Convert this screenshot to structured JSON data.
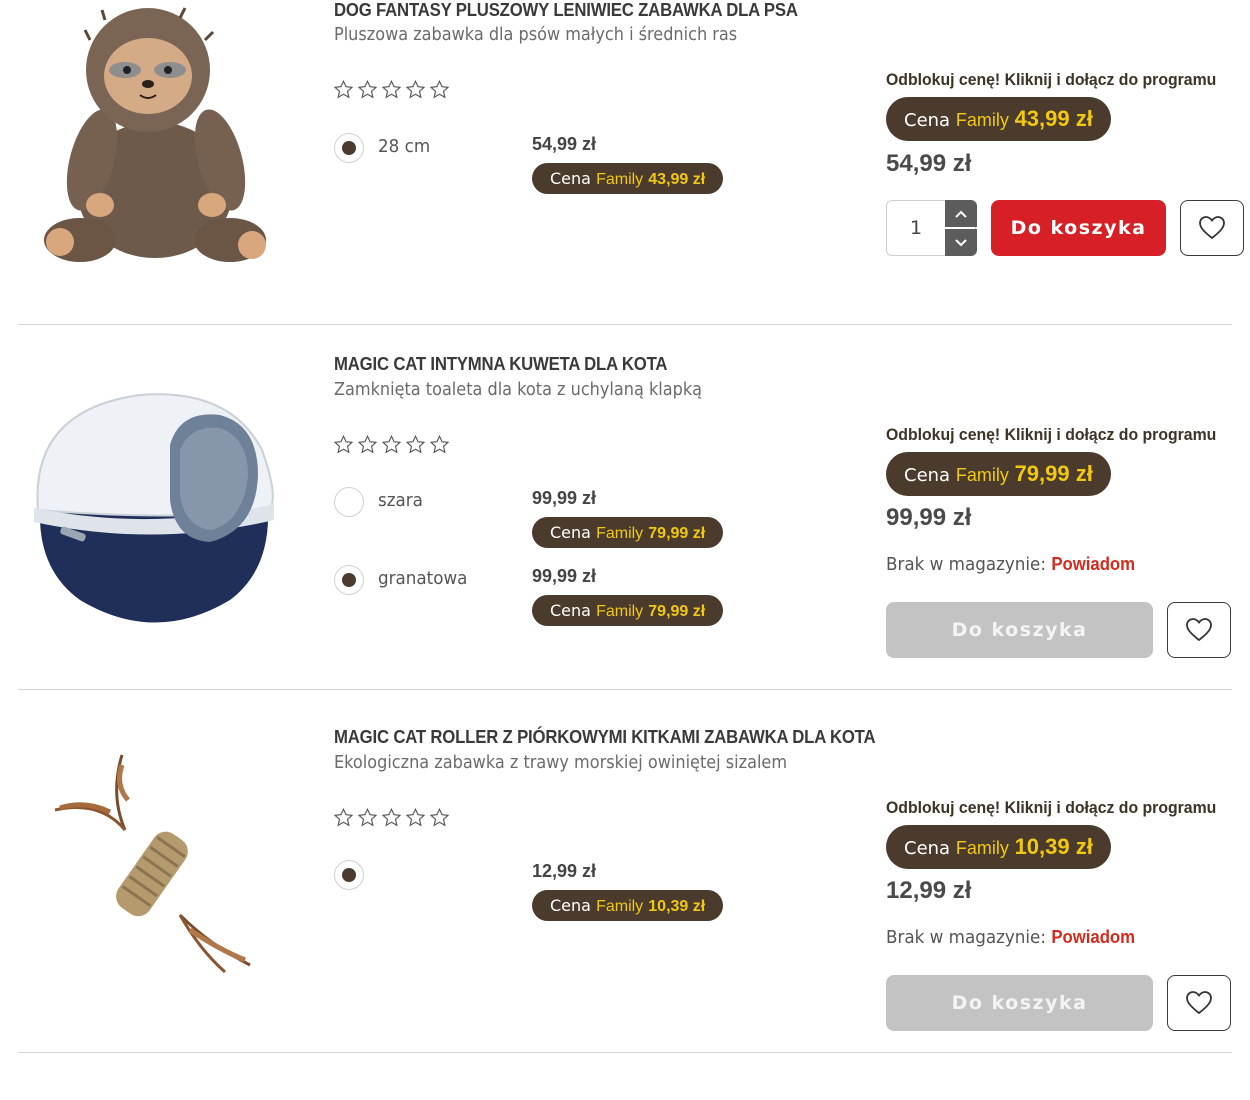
{
  "products": [
    {
      "title": "DOG FANTASY PLUSZOWY LENIWIEC ZABAWKA DLA PSA",
      "subtitle": "Pluszowa zabawka dla psów małych i średnich ras",
      "image_icon": "plush-sloth-image",
      "rating": 0,
      "variants": [
        {
          "name": "28 cm",
          "selected": true,
          "price": "54,99 zł",
          "family_label": "Cena",
          "family_word": "Family",
          "family_price": "43,99 zł"
        }
      ],
      "unlock_text": "Odblokuj cenę! Kliknij i dołącz do programu",
      "family_label": "Cena",
      "family_word": "Family",
      "family_price": "43,99 zł",
      "regular_price": "54,99 zł",
      "in_stock": true,
      "quantity": "1",
      "cart_label": "Do koszyka"
    },
    {
      "title": "MAGIC CAT INTYMNA KUWETA DLA KOTA",
      "subtitle": "Zamknięta toaleta dla kota z uchylaną klapką",
      "image_icon": "litter-box-image",
      "rating": 0,
      "variants": [
        {
          "name": "szara",
          "selected": false,
          "price": "99,99 zł",
          "family_label": "Cena",
          "family_word": "Family",
          "family_price": "79,99 zł"
        },
        {
          "name": "granatowa",
          "selected": true,
          "price": "99,99 zł",
          "family_label": "Cena",
          "family_word": "Family",
          "family_price": "79,99 zł"
        }
      ],
      "unlock_text": "Odblokuj cenę! Kliknij i dołącz do programu",
      "family_label": "Cena",
      "family_word": "Family",
      "family_price": "79,99 zł",
      "regular_price": "99,99 zł",
      "in_stock": false,
      "stock_text": "Brak w magazynie:",
      "notify_text": "Powiadom",
      "cart_label": "Do koszyka"
    },
    {
      "title": "MAGIC CAT ROLLER Z PIÓRKOWYMI KITKAMI ZABAWKA DLA KOTA",
      "subtitle": "Ekologiczna zabawka z trawy morskiej owiniętej sizalem",
      "image_icon": "feather-roller-image",
      "rating": 0,
      "variants": [
        {
          "name": "",
          "selected": true,
          "price": "12,99 zł",
          "family_label": "Cena",
          "family_word": "Family",
          "family_price": "10,39 zł"
        }
      ],
      "unlock_text": "Odblokuj cenę! Kliknij i dołącz do programu",
      "family_label": "Cena",
      "family_word": "Family",
      "family_price": "10,39 zł",
      "regular_price": "12,99 zł",
      "in_stock": false,
      "stock_text": "Brak w magazynie:",
      "notify_text": "Powiadom",
      "cart_label": "Do koszyka"
    }
  ],
  "colors": {
    "brown": "#4a3b2c",
    "gold": "#f2c811",
    "red": "#d71f26",
    "disabled": "#c3c3c3"
  }
}
